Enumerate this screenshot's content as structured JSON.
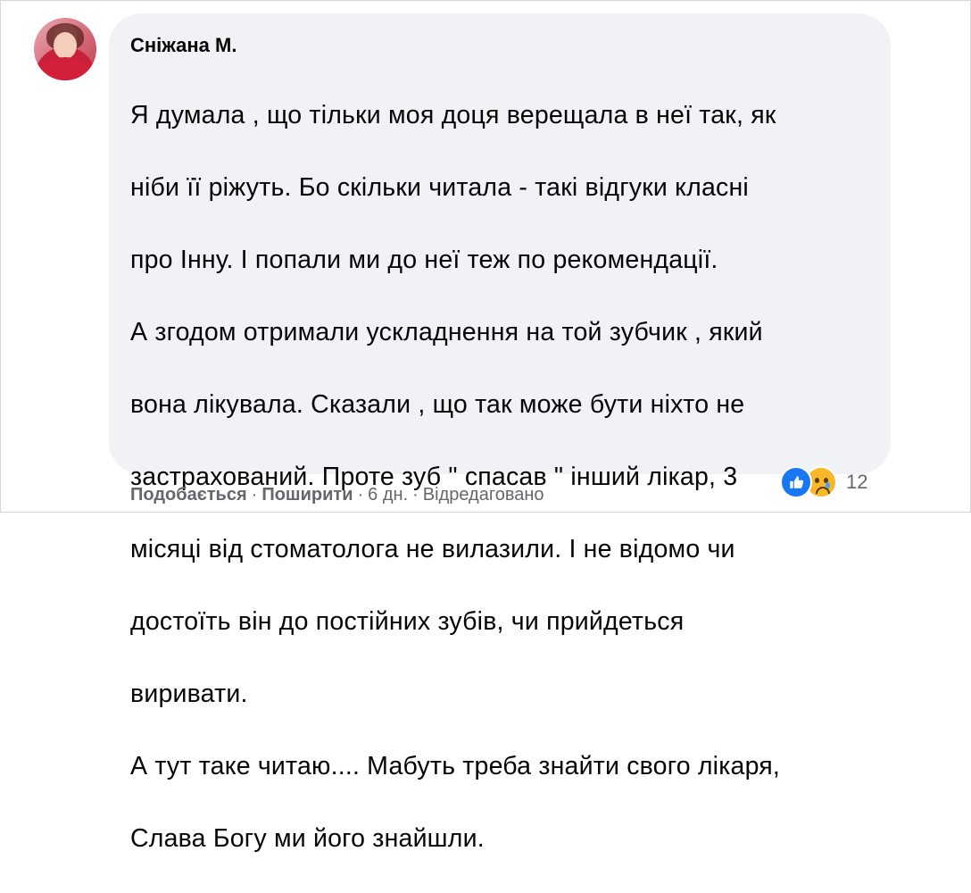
{
  "comment": {
    "author": "Сніжана М.",
    "text_lines": [
      "Я думала , що тільки моя доця верещала в неї так, як",
      "ніби її ріжуть. Бо скільки читала - такі відгуки класні",
      "про Інну. І попали ми до неї теж по рекомендації.",
      "А згодом отримали ускладнення на той зубчик , який",
      "вона лікувала. Сказали , що так може бути ніхто не",
      "застрахований. Проте зуб \" спасав \" інший лікар, 3",
      "місяці від стоматолога не вилазили. І не відомо чи",
      "достоїть він до постійних зубів, чи прийдеться",
      "виривати.",
      "А тут таке читаю.... Мабуть треба знайти свого лікаря,",
      "Слава Богу ми його знайшли."
    ],
    "reactions": {
      "icons": [
        "like-icon",
        "sad-icon"
      ],
      "count": "12",
      "colors": {
        "like": "#1877f2",
        "sad": "#f7b928"
      }
    },
    "actions": {
      "like_label": "Подобається",
      "share_label": "Поширити",
      "separator": "·",
      "time": "6 дн.",
      "edited": "Відредаговано"
    }
  },
  "colors": {
    "bubble_bg": "#f0f2f5",
    "text": "#050505",
    "meta": "#65676b"
  }
}
